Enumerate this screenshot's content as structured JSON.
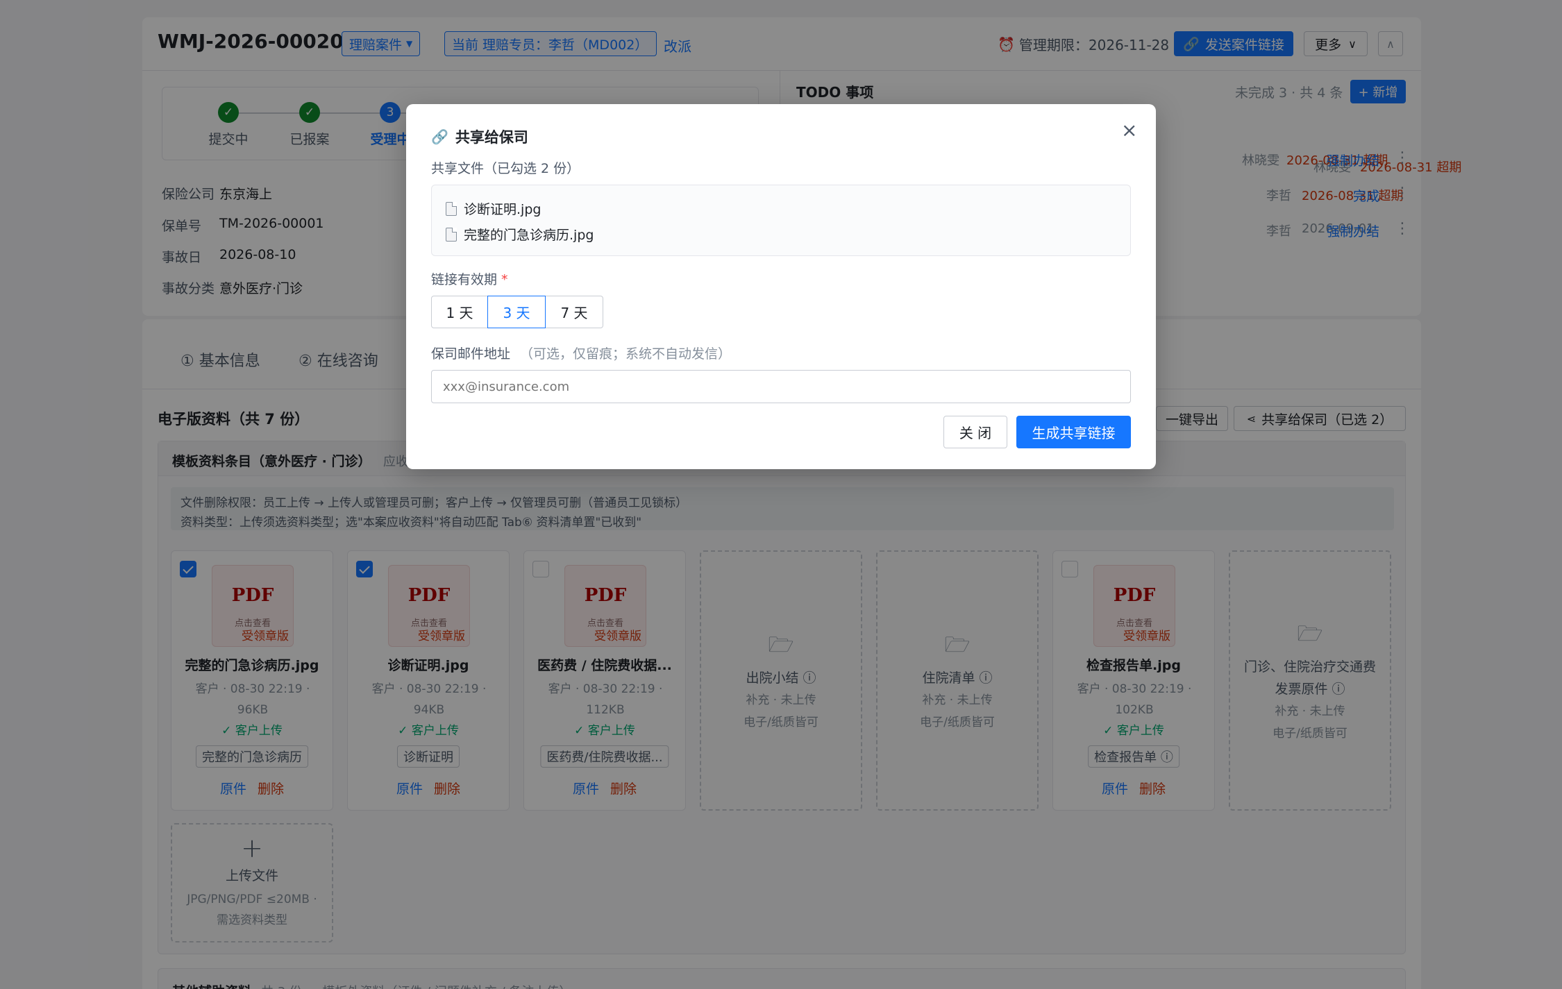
{
  "header": {
    "case_id": "WMJ-2026-00020",
    "case_type": "理赔案件",
    "assignee": "当前 理赔专员：李哲（MD002）",
    "reassign": "改派",
    "deadline": "管理期限：2026-11-28",
    "send_link": "发送案件链接",
    "more": "更多"
  },
  "steps": [
    {
      "label": "提交中",
      "state": "done",
      "mark": "✓"
    },
    {
      "label": "已报案",
      "state": "done",
      "mark": "✓"
    },
    {
      "label": "受理中",
      "state": "active",
      "mark": "3"
    }
  ],
  "info": {
    "insurer_label": "保险公司",
    "insurer": "东京海上",
    "policy_label": "保单号",
    "policy": "TM-2026-00001",
    "date_label": "事故日",
    "date": "2026-08-10",
    "category_label": "事故分类",
    "category": "意外医疗·门诊"
  },
  "todo": {
    "title": "TODO 事项",
    "summary": "未完成 3 · 共 4 条",
    "add": "+ 新增",
    "rows": [
      {
        "user": "林晓雯",
        "date": "2026-08-31 超期",
        "overdue": true,
        "action": "强制办结"
      },
      {
        "user": "李哲",
        "date": "2026-08-31 超期",
        "overdue": true,
        "action": "完成"
      },
      {
        "user": "李哲",
        "date": "2026-09-01",
        "overdue": false,
        "action": "强制办结"
      }
    ]
  },
  "tabs": [
    "① 基本信息",
    "② 在线咨询"
  ],
  "materials": {
    "title": "电子版资料（共 7 份）",
    "export": "一键导出",
    "share": "共享给保司（已选 2）",
    "template_title": "模板资料条目（意外医疗 · 门诊）",
    "template_hint": "应收",
    "note1": "文件删除权限：员工上传 → 上传人或管理员可删；客户上传 → 仅管理员可删（普通员工见锁标）",
    "note2": "资料类型：上传须选资料类型；选\"本案应收资料\"将自动匹配 Tab⑥ 资料清单置\"已收到\"",
    "pdf_label": "PDF",
    "pdf_sub": "点击查看",
    "pdf_badge": "受领章版",
    "files": [
      {
        "checked": true,
        "name": "完整的门急诊病历.jpg",
        "meta1": "客户 · 08-30 22:19 ·",
        "meta2": "96KB",
        "uploader": "✓ 客户上传",
        "tag": "完整的门急诊病历",
        "act1": "原件",
        "act2": "删除"
      },
      {
        "checked": true,
        "name": "诊断证明.jpg",
        "meta1": "客户 · 08-30 22:19 ·",
        "meta2": "94KB",
        "uploader": "✓ 客户上传",
        "tag": "诊断证明",
        "act1": "原件",
        "act2": "删除"
      },
      {
        "checked": false,
        "name": "医药费 / 住院费收据...",
        "meta1": "客户 · 08-30 22:19 ·",
        "meta2": "112KB",
        "uploader": "✓ 客户上传",
        "tag": "医药费/住院费收据...",
        "act1": "原件",
        "act2": "删除"
      },
      {
        "checked": false,
        "name": "检查报告单.jpg",
        "meta1": "客户 · 08-30 22:19 ·",
        "meta2": "102KB",
        "uploader": "✓ 客户上传",
        "tag": "检查报告单 ⓘ",
        "act1": "原件",
        "act2": "删除"
      }
    ],
    "empties": [
      {
        "title": "出院小结 ⓘ",
        "sub1": "补充 · 未上传",
        "sub2": "电子/纸质皆可"
      },
      {
        "title": "住院清单 ⓘ",
        "sub1": "补充 · 未上传",
        "sub2": "电子/纸质皆可"
      },
      {
        "title": "门诊、住院治疗交通费",
        "title2": "发票原件 ⓘ",
        "sub1": "补充 · 未上传",
        "sub2": "电子/纸质皆可"
      }
    ],
    "upload": {
      "plus": "+",
      "title": "上传文件",
      "sub1": "JPG/PNG/PDF ≤20MB ·",
      "sub2": "需选资料类型"
    },
    "other_title": "其他辅助资料",
    "other_hint": "共 3 份 — 模板外资料（证件 / 问题件补充 / 备注上传）"
  },
  "modal": {
    "title": "共享给保司",
    "files_label": "共享文件（已勾选 2 份）",
    "files": [
      "诊断证明.jpg",
      "完整的门急诊病历.jpg"
    ],
    "validity_label": "链接有效期",
    "required": "*",
    "options": [
      "1 天",
      "3 天",
      "7 天"
    ],
    "selected": "3 天",
    "email_label": "保司邮件地址",
    "email_hint": "（可选，仅留痕；系统不自动发信）",
    "email_placeholder": "xxx@insurance.com",
    "close": "关 闭",
    "generate": "生成共享链接"
  }
}
